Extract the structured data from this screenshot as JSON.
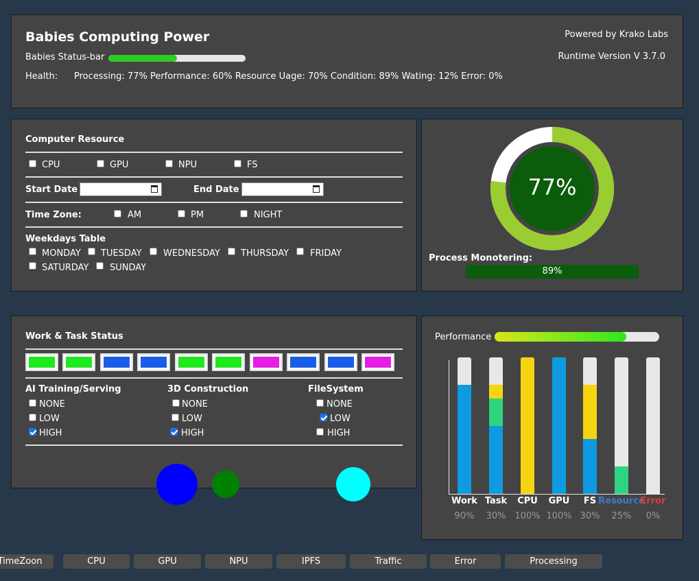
{
  "header": {
    "title": "Babies Computing Power",
    "powered_by": "Powered by Krako Labs",
    "status_bar_label": "Babies Status-bar",
    "runtime_version": "Runtime Version V 3.7.0",
    "status_bar_fill": 0.5,
    "health_label": "Health:",
    "health_values": "Processing: 77% Performance: 60% Resource Uage: 70% Condition: 89% Wating: 12% Error: 0%"
  },
  "resource": {
    "title": "Computer Resource",
    "items": [
      "CPU",
      "GPU",
      "NPU",
      "FS"
    ],
    "start_date_label": "Start Date",
    "end_date_label": "End Date",
    "time_zone_label": "Time Zone:",
    "time_zone_options": [
      "AM",
      "PM",
      "NIGHT"
    ],
    "weekdays_title": "Weekdays Table",
    "weekdays": [
      "MONDAY",
      "TUESDAY",
      "WEDNESDAY",
      "THURSDAY",
      "FRIDAY",
      "SATURDAY",
      "SUNDAY"
    ]
  },
  "monitor": {
    "percent_text": "77%",
    "percent": 77,
    "ring_colors": {
      "fill": "#9acd32",
      "empty": "#ffffff",
      "center": "#0b5c0b"
    },
    "process_label": "Process Monotering:",
    "process_value_text": "89%",
    "process_value": 89
  },
  "work": {
    "title": "Work & Task Status",
    "swatches": [
      "#1ee81e",
      "#1ee81e",
      "#1a5ee8",
      "#1a5ee8",
      "#1ee81e",
      "#1ee81e",
      "#e51ee5",
      "#1a5ee8",
      "#1a5ee8",
      "#e51ee5"
    ],
    "groups": [
      {
        "title": "AI Training/Serving",
        "options": [
          "NONE",
          "LOW",
          "HIGH"
        ],
        "checked": [
          false,
          false,
          true
        ]
      },
      {
        "title": "3D Construction",
        "options": [
          "NONE",
          "LOW",
          "HIGH"
        ],
        "checked": [
          false,
          false,
          true
        ]
      },
      {
        "title": "FileSystem",
        "options": [
          "NONE",
          "LOW",
          "HIGH"
        ],
        "checked": [
          false,
          true,
          false
        ]
      }
    ],
    "circles": [
      "#0000ff",
      "#008000",
      "#00ffff"
    ]
  },
  "performance": {
    "label": "Performance",
    "bar_fill": 0.8,
    "chart_data": {
      "type": "bar",
      "categories": [
        "Work",
        "Task",
        "CPU",
        "GPU",
        "FS",
        "Resource",
        "Error"
      ],
      "category_colors": [
        "#ffffff",
        "#ffffff",
        "#ffffff",
        "#ffffff",
        "#ffffff",
        "#3a7bd5",
        "#e53935"
      ],
      "percent_labels": [
        "90%",
        "30%",
        "100%",
        "100%",
        "30%",
        "25%",
        "0%"
      ],
      "stacks": [
        [
          {
            "value": 80,
            "color": "#0e9ae0"
          }
        ],
        [
          {
            "value": 50,
            "color": "#0e9ae0"
          },
          {
            "value": 20,
            "color": "#2ed480"
          },
          {
            "value": 10,
            "color": "#f5d50f"
          }
        ],
        [
          {
            "value": 100,
            "color": "#f5d50f"
          }
        ],
        [
          {
            "value": 100,
            "color": "#0e9ae0"
          }
        ],
        [
          {
            "value": 40,
            "color": "#0e9ae0"
          },
          {
            "value": 40,
            "color": "#f5d50f"
          }
        ],
        [
          {
            "value": 20,
            "color": "#2ed480"
          }
        ],
        []
      ],
      "ylim": [
        0,
        100
      ]
    }
  },
  "tabs": [
    "TimeZoon",
    "CPU",
    "GPU",
    "NPU",
    "IPFS",
    "Traffic",
    "Error",
    "Processing"
  ]
}
